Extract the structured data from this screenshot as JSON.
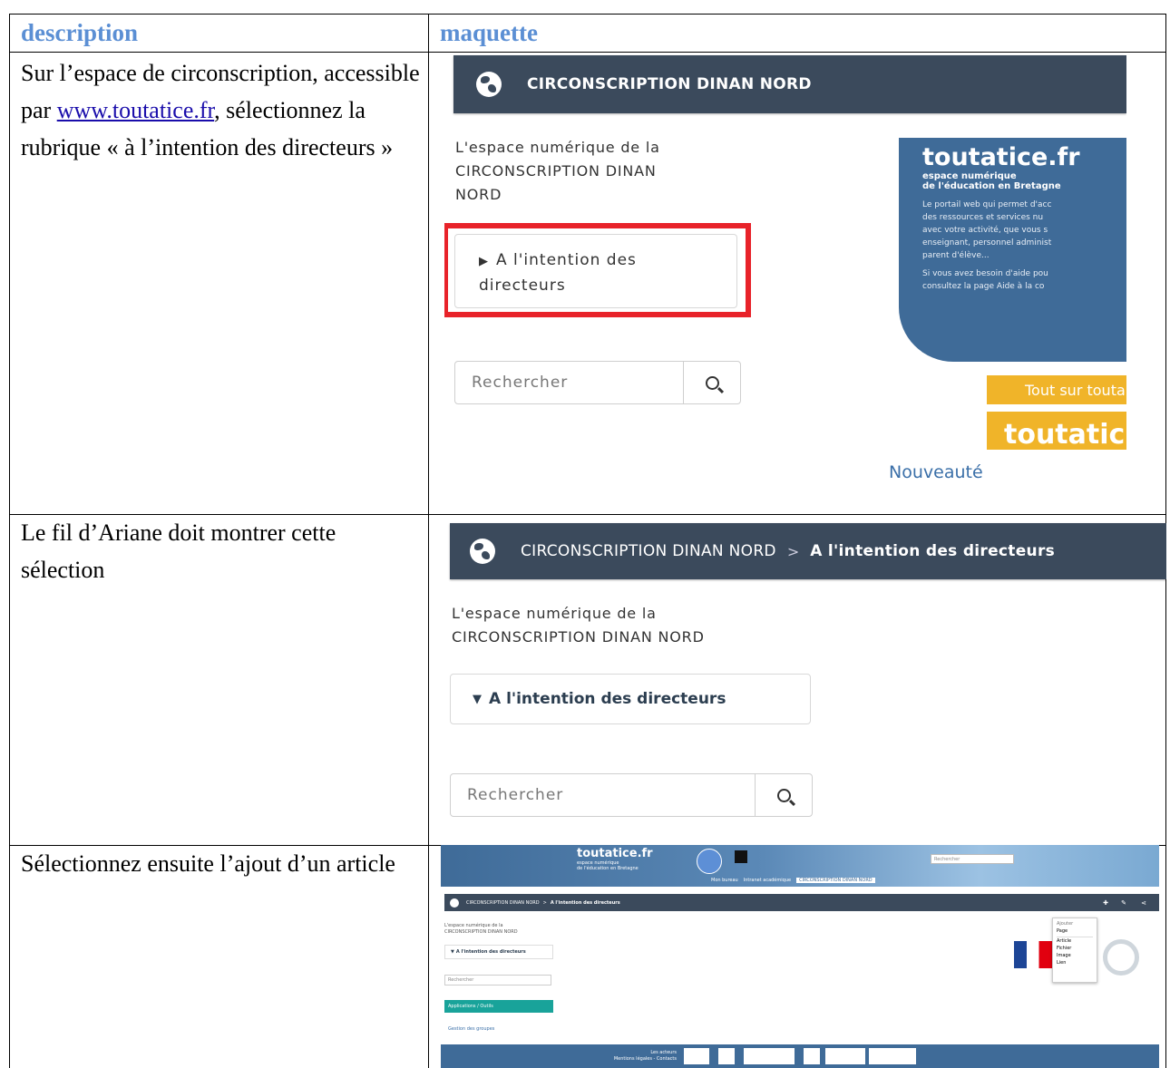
{
  "table": {
    "headers": {
      "description": "description",
      "maquette": "maquette"
    },
    "rows": [
      {
        "desc_before_link": "Sur l’espace de circonscription, accessible par ",
        "desc_link": "www.toutatice.fr",
        "desc_after_link": ", sélectionnez la rubrique « à l’intention des directeurs »"
      },
      {
        "desc": "Le fil d’Ariane doit montrer cette sélection"
      },
      {
        "desc": "Sélectionnez ensuite l’ajout d’un article"
      }
    ]
  },
  "mock1": {
    "nav_title": "CIRCONSCRIPTION DINAN NORD",
    "intro_line1": "L'espace numérique de la",
    "intro_line2": "CIRCONSCRIPTION DINAN",
    "intro_line3": "NORD",
    "menu_line1": "A l'intention des",
    "menu_line2": "directeurs",
    "search_placeholder": "Rechercher",
    "promo_title": "toutatice.fr",
    "promo_sub1": "espace numérique",
    "promo_sub2": "de l'éducation en Bretagne",
    "promo_p1": "Le portail web qui permet d'acc",
    "promo_p2": "des ressources et services nu",
    "promo_p3": "avec votre activité, que vous s",
    "promo_p4": "enseignant, personnel administ",
    "promo_p5": "parent d'élève...",
    "promo_p6": "Si vous avez besoin d'aide pou",
    "promo_p7": "consultez la page Aide à la co",
    "tout_sur": "Tout sur touta",
    "banner": "toutatic",
    "nouveaute": "Nouveauté",
    "highlight_color": "#e8232a"
  },
  "mock2": {
    "crumb_root": "CIRCONSCRIPTION DINAN NORD",
    "crumb_sep": ">",
    "crumb_current": "A l'intention des directeurs",
    "intro_line1": "L'espace numérique de la",
    "intro_line2": "CIRCONSCRIPTION DINAN NORD",
    "menu_label": "A l'intention des directeurs",
    "search_placeholder": "Rechercher"
  },
  "mock3": {
    "header_title": "toutatice.fr",
    "header_sub1": "espace numérique",
    "header_sub2": "de l'éducation en Bretagne",
    "search_placeholder": "Rechercher",
    "tabs": [
      "Mon bureau",
      "Intranet académique",
      "CIRCONSCRIPTION DINAN NORD"
    ],
    "crumb_root": "CIRCONSCRIPTION DINAN NORD",
    "crumb_sep": ">",
    "crumb_current": "A l'intention des directeurs",
    "intro_line1": "L'espace numérique de la",
    "intro_line2": "CIRCONSCRIPTION DINAN NORD",
    "menu_label": "A l'intention des directeurs",
    "apps_label": "Applications / Outils",
    "groups_label": "Gestion des groupes",
    "dropdown_title": "Ajouter",
    "dropdown_items": [
      "Page",
      "Article",
      "Fichier",
      "Image",
      "Lien"
    ],
    "footer_line1": "Les acteurs",
    "footer_line2": "Mentions légales - Contacts"
  }
}
